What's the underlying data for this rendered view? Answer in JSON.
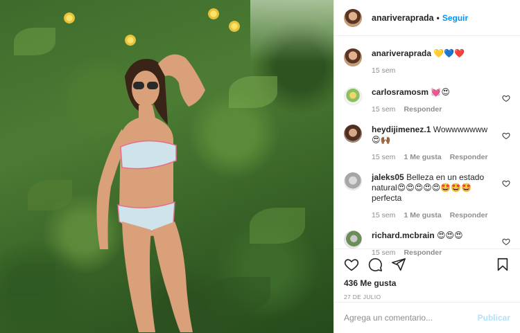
{
  "post": {
    "author": "anariverapra­da",
    "follow_label": "Seguir",
    "dot": "•",
    "caption": {
      "username": "anariveraprada",
      "text": "💛💙❤️",
      "age": "15 sem"
    },
    "comments": [
      {
        "username": "carlosramosm",
        "text": "💓😍",
        "age": "15 sem",
        "likes": "",
        "reply": "Responder"
      },
      {
        "username": "heydijimenez.1",
        "text": "Wowwwwwww😍🙌🏾",
        "age": "15 sem",
        "likes": "1 Me gusta",
        "reply": "Responder"
      },
      {
        "username": "jaleks05",
        "text": "Belleza en un estado natural😍😍😍😍😍🤩🤩🤩perfecta",
        "age": "15 sem",
        "likes": "1 Me gusta",
        "reply": "Responder"
      },
      {
        "username": "richard.mcbrain",
        "text": "😍😍😍",
        "age": "15 sem",
        "likes": "",
        "reply": "Responder"
      }
    ],
    "likes_count": "436 Me gusta",
    "date": "27 DE JULIO",
    "comment_placeholder": "Agrega un comentario...",
    "publish_label": "Publicar"
  },
  "icons": {
    "like": "heart-icon",
    "comment": "comment-icon",
    "share": "paper-plane-icon",
    "save": "bookmark-icon"
  },
  "colors": {
    "link_blue": "#0095f6",
    "publish_disabled": "#b2dffc",
    "meta_gray": "#8e8e8e"
  }
}
